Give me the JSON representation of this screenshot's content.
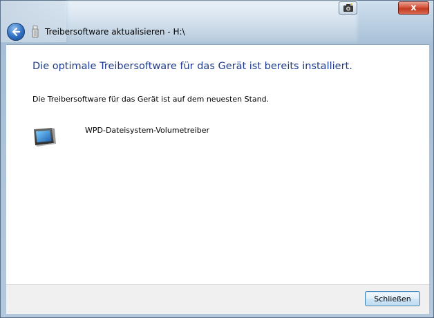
{
  "window": {
    "title": "Treibersoftware aktualisieren - H:\\",
    "close_label": "x"
  },
  "main": {
    "heading": "Die optimale Treibersoftware für das Gerät ist bereits installiert.",
    "message": "Die Treibersoftware für das Gerät ist auf dem neuesten Stand.",
    "device_name": "WPD-Dateisystem-Volumetreiber"
  },
  "footer": {
    "close_button_label": "Schließen"
  },
  "icons": {
    "back": "back-arrow-icon",
    "usb": "usb-drive-icon",
    "device": "portable-device-icon",
    "camera": "camera-icon",
    "close": "close-icon"
  },
  "colors": {
    "heading": "#1e3a8a",
    "close_button": "#c23a22",
    "primary_button_border": "#3c7fb1"
  }
}
